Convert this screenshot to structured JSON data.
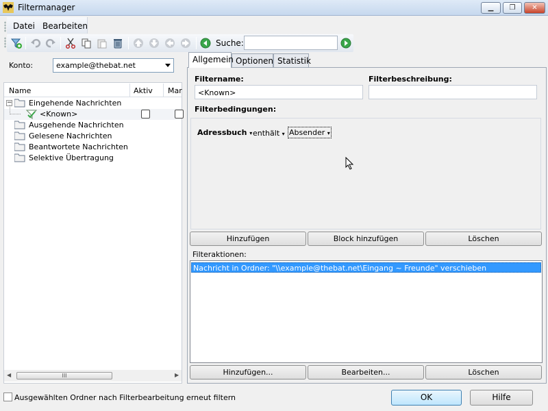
{
  "window": {
    "title": "Filtermanager"
  },
  "menu": {
    "datei": "Datei",
    "bearbeiten": "Bearbeiten"
  },
  "toolbar": {
    "search_label": "Suche:",
    "search_value": "",
    "icons": [
      "add-filter-icon",
      "undo-icon",
      "redo-icon",
      "cut-icon",
      "copy-icon",
      "paste-icon",
      "delete-icon",
      "move-up-icon",
      "move-down-icon",
      "move-left-icon",
      "move-right-icon",
      "search-prev-icon",
      "search-next-icon"
    ]
  },
  "konto": {
    "label": "Konto:",
    "value": "example@thebat.net"
  },
  "tree": {
    "columns": [
      "Name",
      "Aktiv",
      "Mar"
    ],
    "items": [
      {
        "label": "Eingehende Nachrichten",
        "expanded": true
      },
      {
        "label": "<Known>",
        "child": true
      },
      {
        "label": "Ausgehende Nachrichten"
      },
      {
        "label": "Gelesene Nachrichten"
      },
      {
        "label": "Beantwortete Nachrichten"
      },
      {
        "label": "Selektive Übertragung"
      }
    ],
    "scroll_thumb": "III"
  },
  "tabs": [
    "Allgemein",
    "Optionen",
    "Statistik"
  ],
  "general": {
    "filtername_label": "Filtername:",
    "filtername_value": "<Known>",
    "description_label": "Filterbeschreibung:",
    "description_value": "",
    "conditions_label": "Filterbedingungen:",
    "condition": {
      "field": "Adressbuch",
      "op": "enthält",
      "value": "Absender"
    },
    "cond_buttons": [
      "Hinzufügen",
      "Block hinzufügen",
      "Löschen"
    ],
    "actions_label": "Filteraktionen:",
    "actions": [
      "Nachricht in Ordner: \"\\\\example@thebat.net\\Eingang ~ Freunde\" verschieben"
    ],
    "action_buttons": [
      "Hinzufügen...",
      "Bearbeiten...",
      "Löschen"
    ]
  },
  "footer": {
    "refilter_label": "Ausgewählten Ordner nach Filterbearbeitung erneut filtern",
    "ok": "OK",
    "help": "Hilfe"
  }
}
